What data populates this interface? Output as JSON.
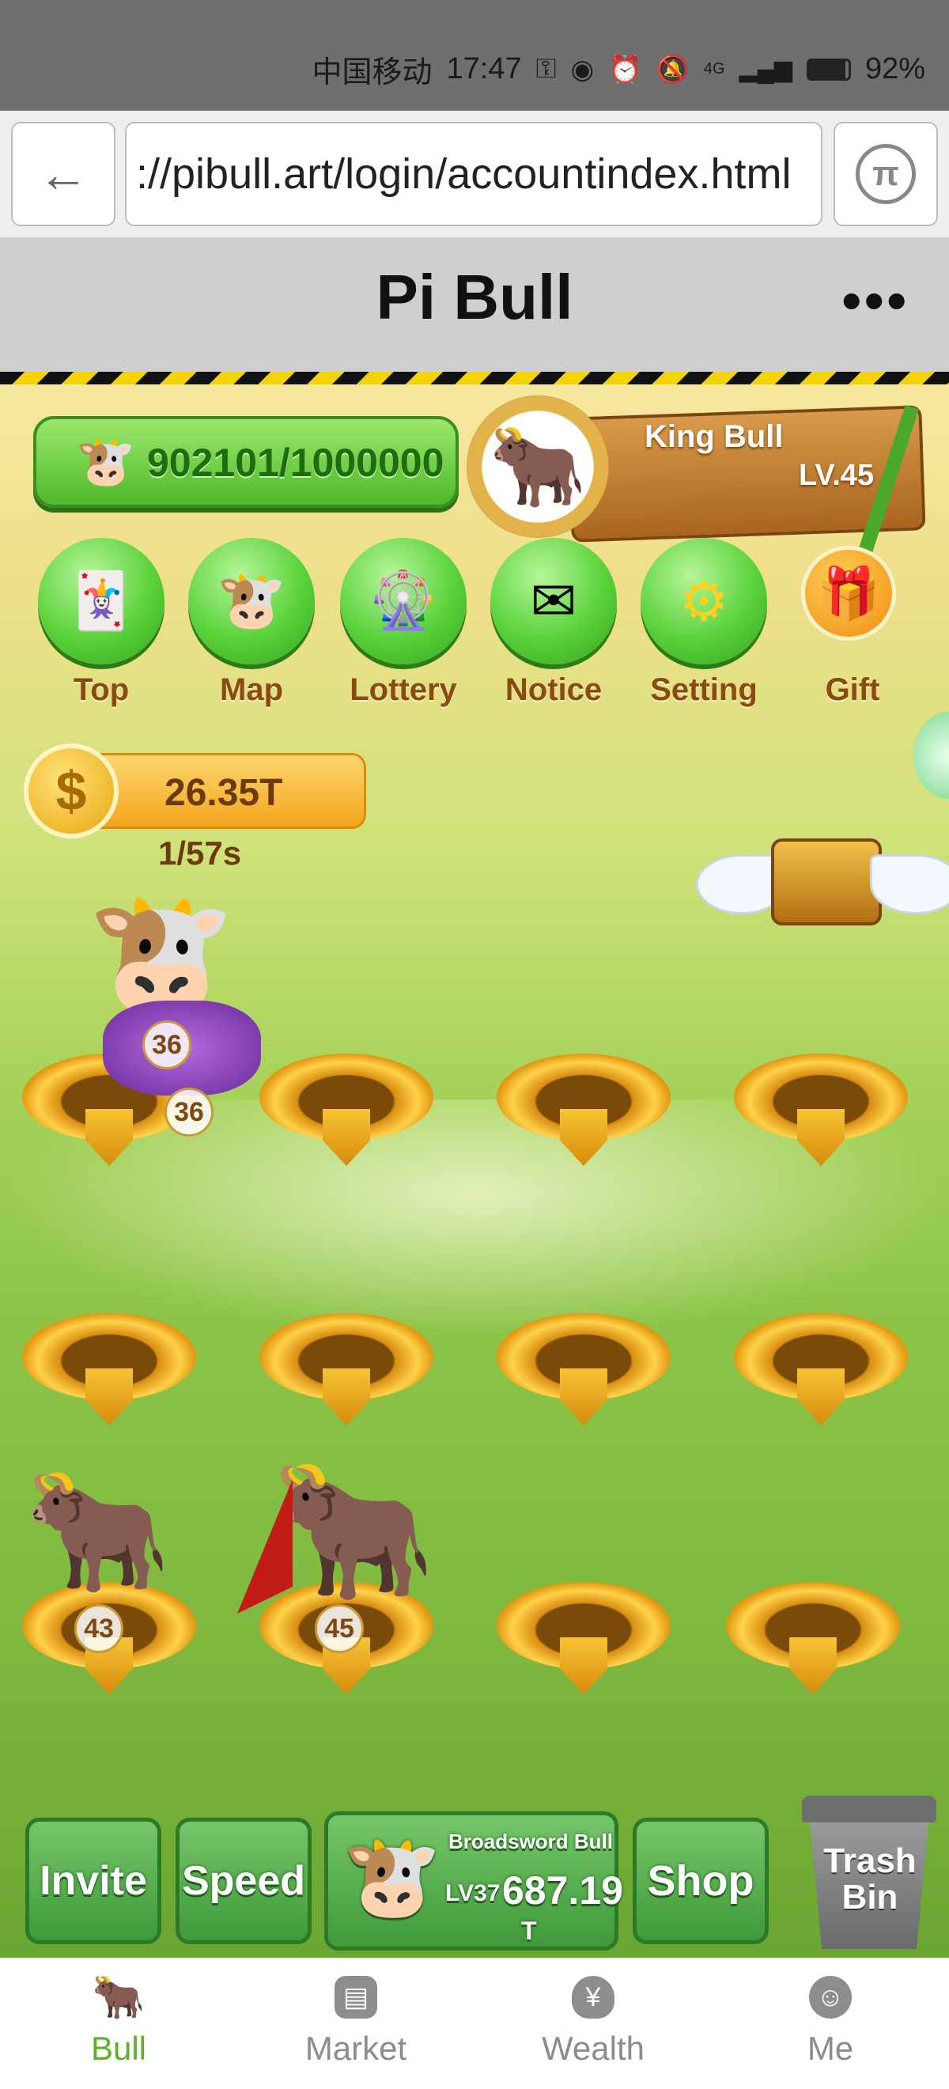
{
  "status_bar": {
    "carrier": "中国移动",
    "time": "17:47",
    "signal": "4G",
    "battery": "92%"
  },
  "browser": {
    "url": "://pibull.art/login/accountindex.html",
    "back_icon": "back-arrow-icon",
    "pi_icon": "pi-logo-icon"
  },
  "page": {
    "title": "Pi Bull",
    "more": "•••"
  },
  "game": {
    "progress": "902101/1000000",
    "progress_fraction": 0.902,
    "player": {
      "name": "King Bull",
      "level": "LV.45"
    },
    "menu": [
      {
        "label": "Top",
        "icon": "cards-icon"
      },
      {
        "label": "Map",
        "icon": "bull-map-icon"
      },
      {
        "label": "Lottery",
        "icon": "wheel-icon"
      },
      {
        "label": "Notice",
        "icon": "envelope-icon"
      },
      {
        "label": "Setting",
        "icon": "gear-icon"
      },
      {
        "label": "Gift",
        "icon": "gift-icon"
      }
    ],
    "coins": "26.35T",
    "rate": "1/57s",
    "slots": [
      {
        "row": 1,
        "bull_levels": [
          "36",
          "36"
        ]
      },
      {
        "row": 1,
        "bull_levels": []
      },
      {
        "row": 1,
        "bull_levels": []
      },
      {
        "row": 1,
        "bull_levels": []
      },
      {
        "row": 2,
        "bull_levels": []
      },
      {
        "row": 2,
        "bull_levels": []
      },
      {
        "row": 2,
        "bull_levels": []
      },
      {
        "row": 2,
        "bull_levels": []
      },
      {
        "row": 3,
        "bull_levels": [
          "43"
        ]
      },
      {
        "row": 3,
        "bull_levels": [
          "45"
        ]
      },
      {
        "row": 3,
        "bull_levels": []
      },
      {
        "row": 3,
        "bull_levels": []
      }
    ],
    "actions": {
      "invite": "Invite",
      "speed": "Speed",
      "buy": {
        "name": "Broadsword Bull",
        "level": "LV37",
        "price": "687.19",
        "suffix": "T"
      },
      "shop": "Shop",
      "trash": "Trash Bin"
    }
  },
  "nav": [
    {
      "label": "Bull",
      "active": true,
      "icon": "bull-icon"
    },
    {
      "label": "Market",
      "active": false,
      "icon": "shop-icon"
    },
    {
      "label": "Wealth",
      "active": false,
      "icon": "money-bag-icon"
    },
    {
      "label": "Me",
      "active": false,
      "icon": "face-icon"
    }
  ]
}
